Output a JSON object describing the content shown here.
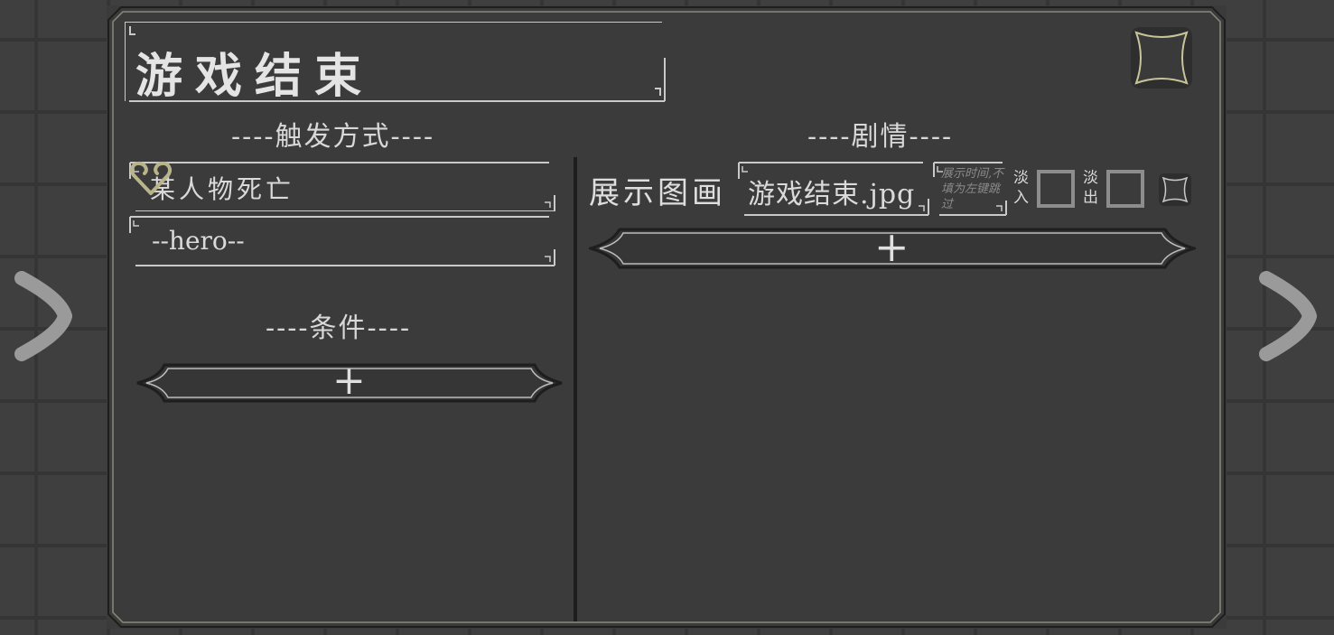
{
  "title": "游戏结束",
  "trigger": {
    "header": "----触发方式----",
    "type_value": "某人物死亡",
    "target_value": "--hero--"
  },
  "conditions": {
    "header": "----条件----",
    "add_label": "+"
  },
  "story": {
    "header": "----剧情----",
    "row": {
      "action_label": "展示图画",
      "image_value": "游戏结束.jpg",
      "time_placeholder": "展示时间,不填为左键跳过",
      "fade_in_label": "淡入",
      "fade_out_label": "淡出",
      "fade_in_checked": false,
      "fade_out_checked": false
    },
    "add_label": "+"
  },
  "icons": {
    "close": "close-icon",
    "nav_prev": "chevron-left-icon",
    "nav_next": "chevron-right-icon",
    "dropdown": "heart-dropdown-icon"
  },
  "colors": {
    "background": "#3f3f3f",
    "panel": "#3b3b3b",
    "accent_gold": "#b9b48a",
    "text": "#d6d6d6",
    "divider": "#1d1d1d"
  }
}
